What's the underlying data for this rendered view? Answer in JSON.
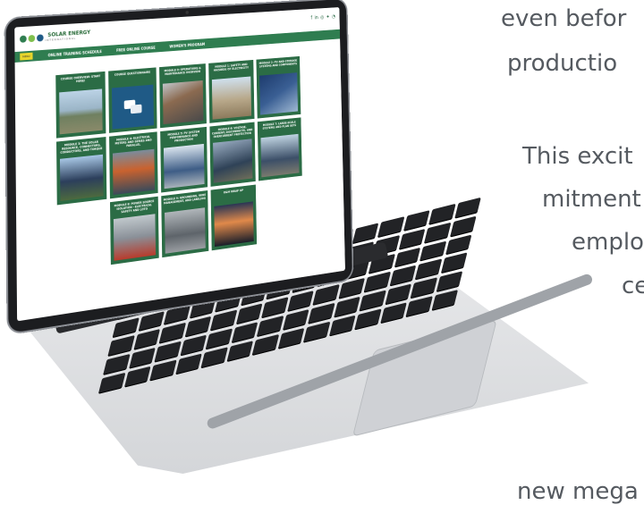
{
  "side_text": [
    "even befor",
    "productio",
    "This excit",
    "mitment",
    "employe",
    "ce",
    "new mega"
  ],
  "site": {
    "logo": {
      "name": "SOLAR ENERGY",
      "sub": "INTERNATIONAL",
      "colors": [
        "#2f7d50",
        "#7fbf4d",
        "#1f5a86"
      ]
    },
    "nav": {
      "menu_label": "MENU",
      "items": [
        "ONLINE TRAINING SCHEDULE",
        "FREE ONLINE COURSE",
        "WOMEN'S PROGRAM"
      ]
    },
    "social_icons": [
      "facebook-icon",
      "linkedin-icon",
      "instagram-icon",
      "twitter-icon",
      "rss-icon"
    ],
    "cards": [
      {
        "title": "COURSE OVERVIEW: START HERE!"
      },
      {
        "title": "COURSE QUESTIONNAIRE"
      },
      {
        "title": "MODULE 0: OPERATIONS & MAINTENANCE OVERVIEW"
      },
      {
        "title": "MODULE 1: SAFETY AND HAZARDS OF ELECTRICITY"
      },
      {
        "title": "MODULE 2: PV AND STORAGE SYSTEMS AND COMPONENTS"
      },
      {
        "title": "MODULE 3: THE SOLAR RESOURCE, CONNECTORS, CONDUCTORS, AND TORQUE"
      },
      {
        "title": "MODULE 4: ELECTRICAL METERS AND SERIES AND PARALLEL"
      },
      {
        "title": "MODULE 5: PV SYSTEM PERFORMANCE AND PRODUCTION"
      },
      {
        "title": "MODULE 6: VOLTAGE, CURRENT, DISCONNECTS, AND OVERCURRENT PROTECTION"
      },
      {
        "title": "MODULE 7: LARGE-SCALE SYSTEMS AND PLAN SETS"
      },
      {
        "title": "MODULE 8: POWER SOURCE ISOLATION - ELECTRICAL SAFETY AND LOTO"
      },
      {
        "title": "MODULE 9: GROUNDING, WIRE MANAGEMENT, AND LABELING"
      },
      {
        "title": "O&M WRAP UP"
      }
    ],
    "theme": {
      "green": "#2f7d50",
      "card_green": "#2b6c45",
      "menu_yellow": "#e8d52b"
    }
  }
}
